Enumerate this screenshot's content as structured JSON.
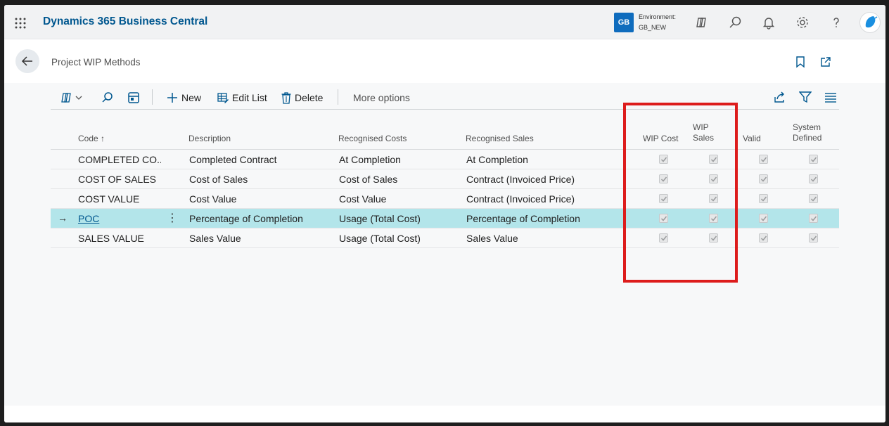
{
  "app": {
    "title": "Dynamics 365 Business Central",
    "env_badge": "GB",
    "env_label": "Environment:",
    "env_value": "GB_NEW"
  },
  "icons": [
    "waffle-icon",
    "copilot-icon",
    "search-icon",
    "bell-icon",
    "gear-icon",
    "help-icon",
    "avatar-icon",
    "back-arrow-icon",
    "bookmark-icon",
    "open-new-icon",
    "share-icon",
    "filter-icon",
    "list-icon"
  ],
  "page": {
    "title": "Project WIP Methods"
  },
  "actions": {
    "new": "New",
    "edit_list": "Edit List",
    "delete": "Delete",
    "more_options": "More options"
  },
  "columns": {
    "code": "Code ↑",
    "description": "Description",
    "recognised_costs": "Recognised Costs",
    "recognised_sales": "Recognised Sales",
    "wip_cost": "WIP Cost",
    "wip_sales_1": "WIP",
    "wip_sales_2": "Sales",
    "valid": "Valid",
    "system_defined_1": "System",
    "system_defined_2": "Defined"
  },
  "rows": [
    {
      "code": "COMPLETED CO...",
      "description": "Completed Contract",
      "recognised_costs": "At Completion",
      "recognised_sales": "At Completion",
      "wip_cost": true,
      "wip_sales": true,
      "valid": true,
      "system_defined": true
    },
    {
      "code": "COST OF SALES",
      "description": "Cost of Sales",
      "recognised_costs": "Cost of Sales",
      "recognised_sales": "Contract (Invoiced Price)",
      "wip_cost": true,
      "wip_sales": true,
      "valid": true,
      "system_defined": true
    },
    {
      "code": "COST VALUE",
      "description": "Cost Value",
      "recognised_costs": "Cost Value",
      "recognised_sales": "Contract (Invoiced Price)",
      "wip_cost": true,
      "wip_sales": true,
      "valid": true,
      "system_defined": true
    },
    {
      "code": "POC",
      "description": "Percentage of Completion",
      "recognised_costs": "Usage (Total Cost)",
      "recognised_sales": "Percentage of Completion",
      "wip_cost": true,
      "wip_sales": true,
      "valid": true,
      "system_defined": true,
      "selected": true
    },
    {
      "code": "SALES VALUE",
      "description": "Sales Value",
      "recognised_costs": "Usage (Total Cost)",
      "recognised_sales": "Sales Value",
      "wip_cost": true,
      "wip_sales": true,
      "valid": true,
      "system_defined": true
    }
  ],
  "colors": {
    "brand": "#00578f",
    "selected_row": "#b3e5ea",
    "highlight_box": "#dd1c1c",
    "badge": "#0f6cbd"
  }
}
